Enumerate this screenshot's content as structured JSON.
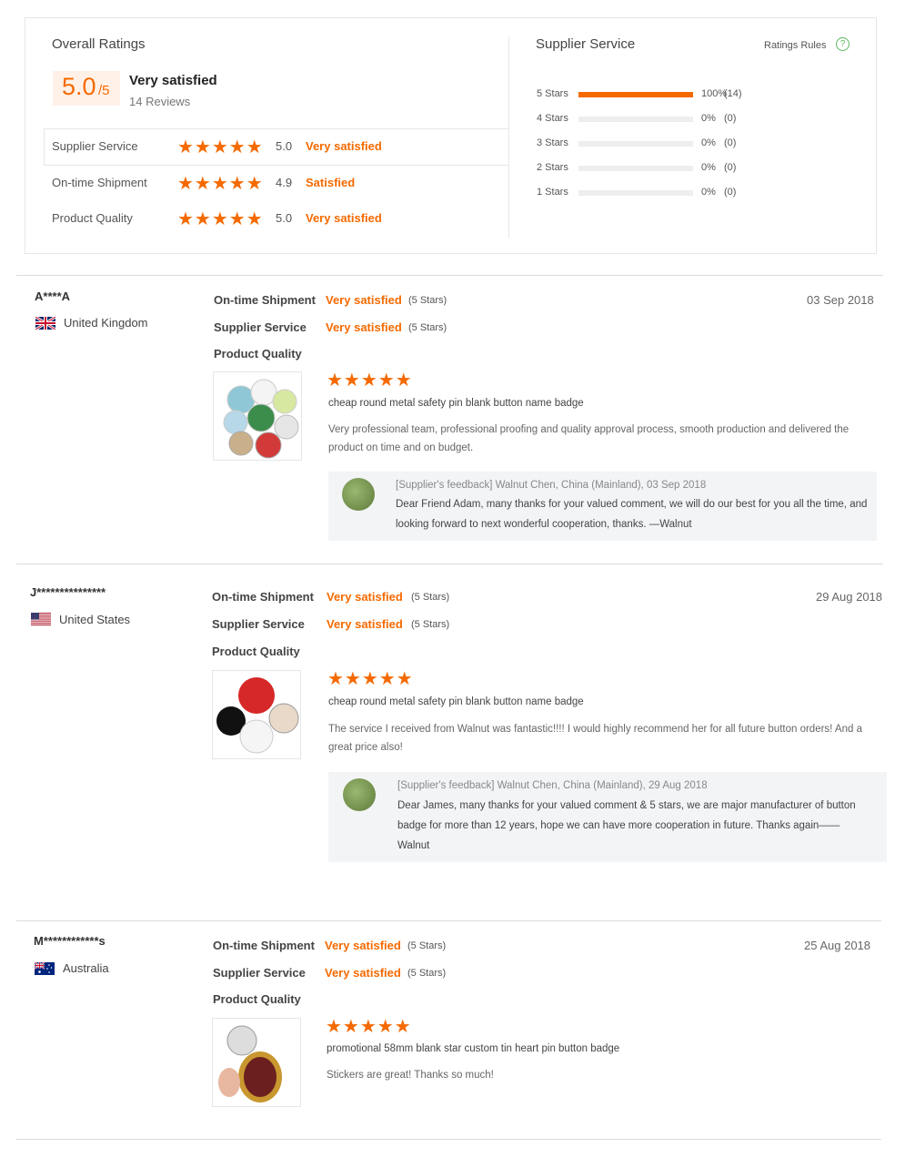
{
  "summary": {
    "title": "Overall Ratings",
    "score": "5.0",
    "score_denominator": "/5",
    "verdict": "Very satisfied",
    "reviews": "14 Reviews",
    "rows": [
      {
        "label": "Supplier Service",
        "stars": "★★★★★",
        "score": "5.0",
        "verdict": "Very satisfied"
      },
      {
        "label": "On-time Shipment",
        "stars": "★★★★★",
        "score": "4.9",
        "verdict": "Satisfied"
      },
      {
        "label": "Product Quality",
        "stars": "★★★★★",
        "score": "5.0",
        "verdict": "Very satisfied"
      }
    ]
  },
  "supplier_service": {
    "title": "Supplier Service",
    "rules_label": "Ratings Rules",
    "rules_icon": "?",
    "bars": [
      {
        "label": "5 Stars",
        "fill": 1.0,
        "pct": "100%",
        "count": "(14)"
      },
      {
        "label": "4 Stars",
        "fill": 0,
        "pct": "0%",
        "count": "(0)"
      },
      {
        "label": "3 Stars",
        "fill": 0,
        "pct": "0%",
        "count": "(0)"
      },
      {
        "label": "2 Stars",
        "fill": 0,
        "pct": "0%",
        "count": "(0)"
      },
      {
        "label": "1 Stars",
        "fill": 0,
        "pct": "0%",
        "count": "(0)"
      }
    ]
  },
  "labels": {
    "ontime": "On-time Shipment",
    "service": "Supplier Service",
    "quality": "Product Quality"
  },
  "reviews": [
    {
      "user": "A****A",
      "country": "United Kingdom",
      "flag_icon": "uk-flag-icon",
      "ontime_verdict": "Very satisfied",
      "ontime_stars": "(5 Stars)",
      "service_verdict": "Very satisfied",
      "service_stars": "(5 Stars)",
      "date": "03 Sep 2018",
      "stars": "★★★★★",
      "product": "cheap round metal safety pin blank button name badge",
      "text": "Very professional team, professional proofing and quality approval process, smooth production and delivered the product on time and on budget.",
      "feedback_head": "[Supplier's feedback] Walnut Chen, China (Mainland), 03 Sep 2018",
      "feedback_text": "Dear Friend Adam, many thanks for your valued comment, we will do our best for you all the time, and looking forward to next wonderful cooperation, thanks. —Walnut"
    },
    {
      "user": "J***************",
      "country": "United States",
      "flag_icon": "us-flag-icon",
      "ontime_verdict": "Very satisfied",
      "ontime_stars": "(5 Stars)",
      "service_verdict": "Very satisfied",
      "service_stars": "(5 Stars)",
      "date": "29 Aug 2018",
      "stars": "★★★★★",
      "product": "cheap round metal safety pin blank button name badge",
      "text": "The service I received from Walnut was fantastic!!!! I would highly recommend her for all future button orders! And a great price also!",
      "feedback_head": "[Supplier's feedback] Walnut Chen, China (Mainland), 29 Aug 2018",
      "feedback_text": "Dear James, many thanks for your valued comment & 5 stars, we are major manufacturer of button badge for more than 12 years, hope we can have more cooperation in future. Thanks again——Walnut"
    },
    {
      "user": "M************s",
      "country": "Australia",
      "flag_icon": "au-flag-icon",
      "ontime_verdict": "Very satisfied",
      "ontime_stars": "(5 Stars)",
      "service_verdict": "Very satisfied",
      "service_stars": "(5 Stars)",
      "date": "25 Aug 2018",
      "stars": "★★★★★",
      "product": "promotional 58mm blank star custom tin heart pin button badge",
      "text": "Stickers are great! Thanks so much!"
    }
  ]
}
